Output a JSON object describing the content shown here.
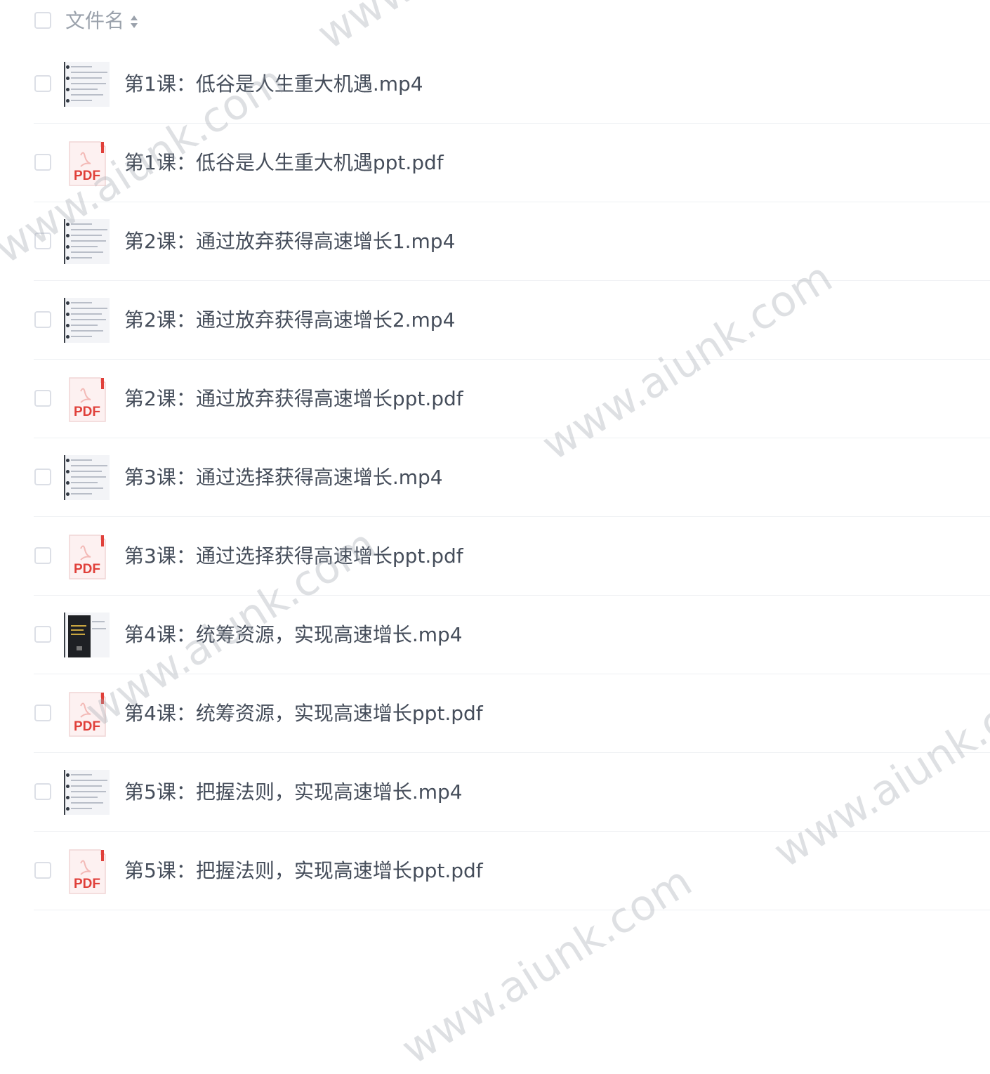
{
  "header": {
    "column_label": "文件名"
  },
  "files": [
    {
      "name": "第1课：低谷是人生重大机遇.mp4",
      "type": "video"
    },
    {
      "name": "第1课：低谷是人生重大机遇ppt.pdf",
      "type": "pdf"
    },
    {
      "name": "第2课：通过放弃获得高速增长1.mp4",
      "type": "video"
    },
    {
      "name": "第2课：通过放弃获得高速增长2.mp4",
      "type": "video"
    },
    {
      "name": "第2课：通过放弃获得高速增长ppt.pdf",
      "type": "pdf"
    },
    {
      "name": "第3课：通过选择获得高速增长.mp4",
      "type": "video"
    },
    {
      "name": "第3课：通过选择获得高速增长ppt.pdf",
      "type": "pdf"
    },
    {
      "name": "第4课：统筹资源，实现高速增长.mp4",
      "type": "video-dark"
    },
    {
      "name": "第4课：统筹资源，实现高速增长ppt.pdf",
      "type": "pdf"
    },
    {
      "name": "第5课：把握法则，实现高速增长.mp4",
      "type": "video"
    },
    {
      "name": "第5课：把握法则，实现高速增长ppt.pdf",
      "type": "pdf"
    }
  ],
  "pdf_badge": "PDF",
  "watermark": "www.aiunk.com",
  "colors": {
    "text": "#454d5a",
    "header_text": "#9aa1ab",
    "pdf_red": "#e0403a",
    "divider": "#eef0f3",
    "checkbox_border": "#dcdfe6"
  }
}
